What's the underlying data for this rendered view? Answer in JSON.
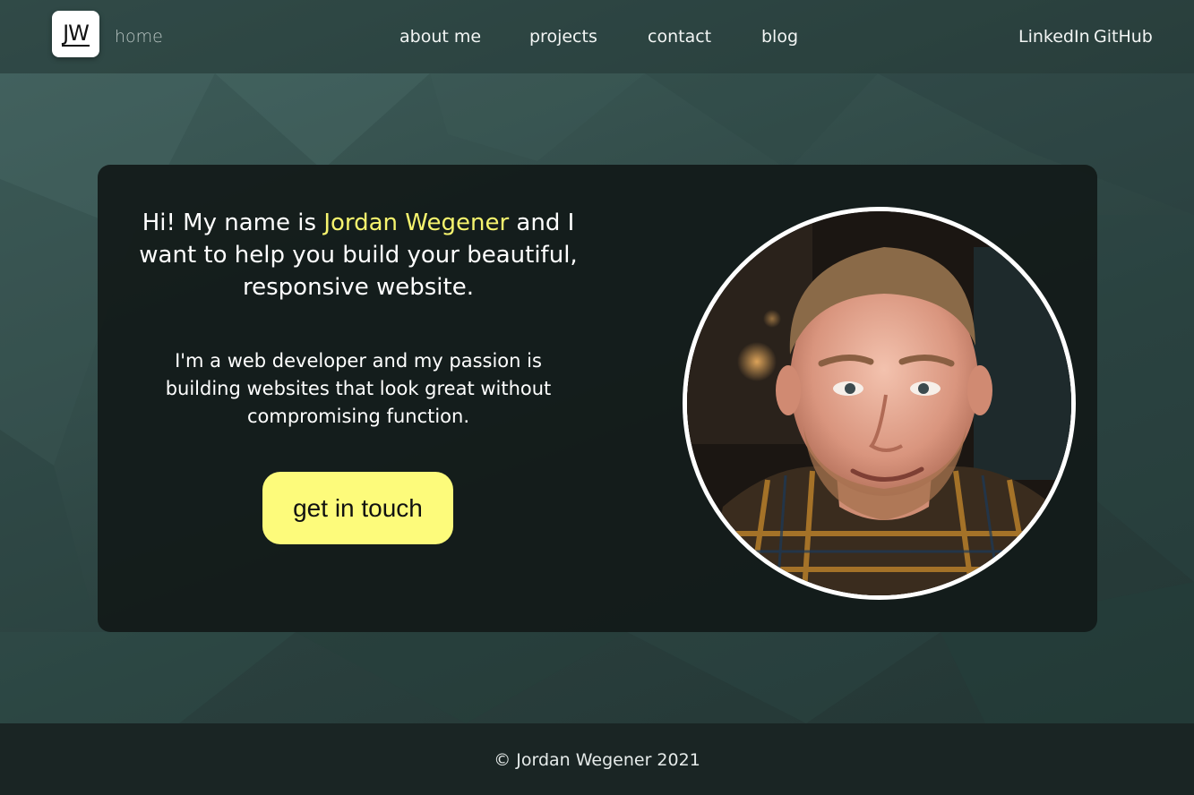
{
  "header": {
    "logo_text": "JW",
    "home_label": "home",
    "nav": [
      "about me",
      "projects",
      "contact",
      "blog"
    ],
    "social": [
      "LinkedIn",
      "GitHub"
    ]
  },
  "hero": {
    "intro_before": "Hi! My name is ",
    "intro_name": "Jordan Wegener",
    "intro_after": " and I want to help you build your beautiful, responsive website.",
    "passion": "I'm a web developer and my passion is building websites that look great without compromising function.",
    "cta_label": "get in touch"
  },
  "footer": {
    "copyright": "© Jordan Wegener 2021"
  },
  "colors": {
    "accent": "#f6f46e",
    "button": "#fdfb7b",
    "card": "#121a19"
  }
}
